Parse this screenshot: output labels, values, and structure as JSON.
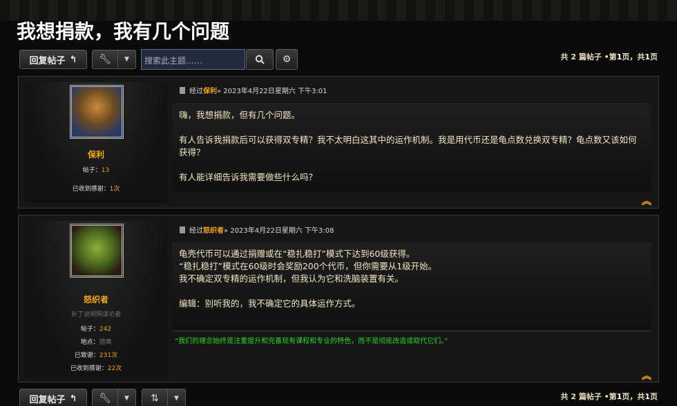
{
  "page": {
    "title": "我想捐款，我有几个问题"
  },
  "toolbar": {
    "reply_label": "回复帖子",
    "reply_icon": "reply-arrow-icon",
    "tools_icon": "wrench-icon",
    "search_placeholder": "搜索此主题……",
    "search_icon": "search-icon",
    "settings_icon": "gear-icon",
    "sort_icon": "sort-icon"
  },
  "pagination": {
    "prefix": "共 2 篇帖子 •第",
    "page": "1",
    "mid": "页，共",
    "total": "1",
    "suffix": "页"
  },
  "posts": [
    {
      "author": "保利",
      "posts_label": "帖子：",
      "posts_count": "13",
      "thanks_received_label": "已收到感谢：",
      "thanks_received": "1次",
      "meta_prefix": "经过",
      "date": "» 2023年4月22日星期六 下午3:01",
      "paragraphs": [
        "嗨，我想捐款，但有几个问题。",
        "有人告诉我捐款后可以获得双专精？我不太明白这其中的运作机制。我是用代币还是龟点数兑换双专精？龟点数又该如何获得？",
        "有人能详细告诉我需要做些什么吗？"
      ]
    },
    {
      "author": "怒织者",
      "rank": "补丁说明阴谋论者",
      "posts_label": "帖子：",
      "posts_count": "242",
      "location_label": "地点：",
      "location": "猎鹰",
      "thanks_given_label": "已致谢：",
      "thanks_given": "231次",
      "thanks_received_label": "已收到感谢：",
      "thanks_received": "22次",
      "meta_prefix": "经过",
      "date": "» 2023年4月22日星期六 下午3:08",
      "lines": [
        "龟壳代币可以通过捐赠或在“稳扎稳打”模式下达到60级获得。",
        "“稳扎稳打”模式在60级时会奖励200个代币，但你需要从1级开始。",
        "我不确定双专精的运作机制，但我认为它和洗脑装置有关。"
      ],
      "edit": "编辑：别听我的，我不确定它的具体运作方式。",
      "signature": "“我们的理念始终是注重提升和完善现有课程和专业的特色，而不是彻底改造或取代它们。”"
    }
  ],
  "colors": {
    "accent": "#f3a51c",
    "signature": "#2bd62b",
    "background": "#0b0b0b"
  }
}
